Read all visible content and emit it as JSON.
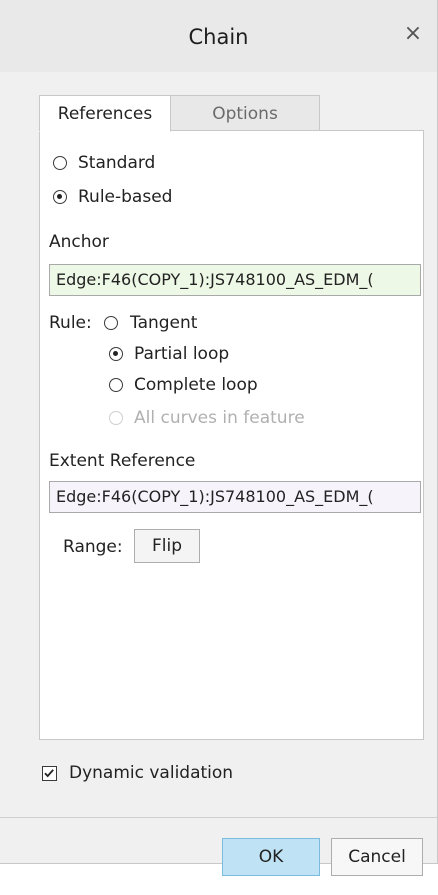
{
  "window": {
    "title": "Chain",
    "close_glyph": "×"
  },
  "tabs": [
    {
      "label": "References",
      "active": true
    },
    {
      "label": "Options",
      "active": false
    }
  ],
  "selection_mode": {
    "options": [
      {
        "label": "Standard",
        "checked": false
      },
      {
        "label": "Rule-based",
        "checked": true
      }
    ]
  },
  "anchor": {
    "label": "Anchor",
    "value": "Edge:F46(COPY_1):JS748100_AS_EDM_("
  },
  "rule": {
    "label": "Rule:",
    "options": [
      {
        "label": "Tangent",
        "checked": false,
        "enabled": true
      },
      {
        "label": "Partial loop",
        "checked": true,
        "enabled": true
      },
      {
        "label": "Complete loop",
        "checked": false,
        "enabled": true
      },
      {
        "label": "All curves in feature",
        "checked": false,
        "enabled": false
      }
    ]
  },
  "extent": {
    "label": "Extent Reference",
    "value": "Edge:F46(COPY_1):JS748100_AS_EDM_("
  },
  "range": {
    "label": "Range:",
    "flip_label": "Flip"
  },
  "dynamic_validation": {
    "label": "Dynamic validation",
    "checked": true
  },
  "footer": {
    "ok_label": "OK",
    "cancel_label": "Cancel"
  },
  "colors": {
    "ok_button_bg": "#bfe3f4",
    "anchor_field_bg": "#eef8e6",
    "extent_field_bg": "#f7f3fb"
  }
}
